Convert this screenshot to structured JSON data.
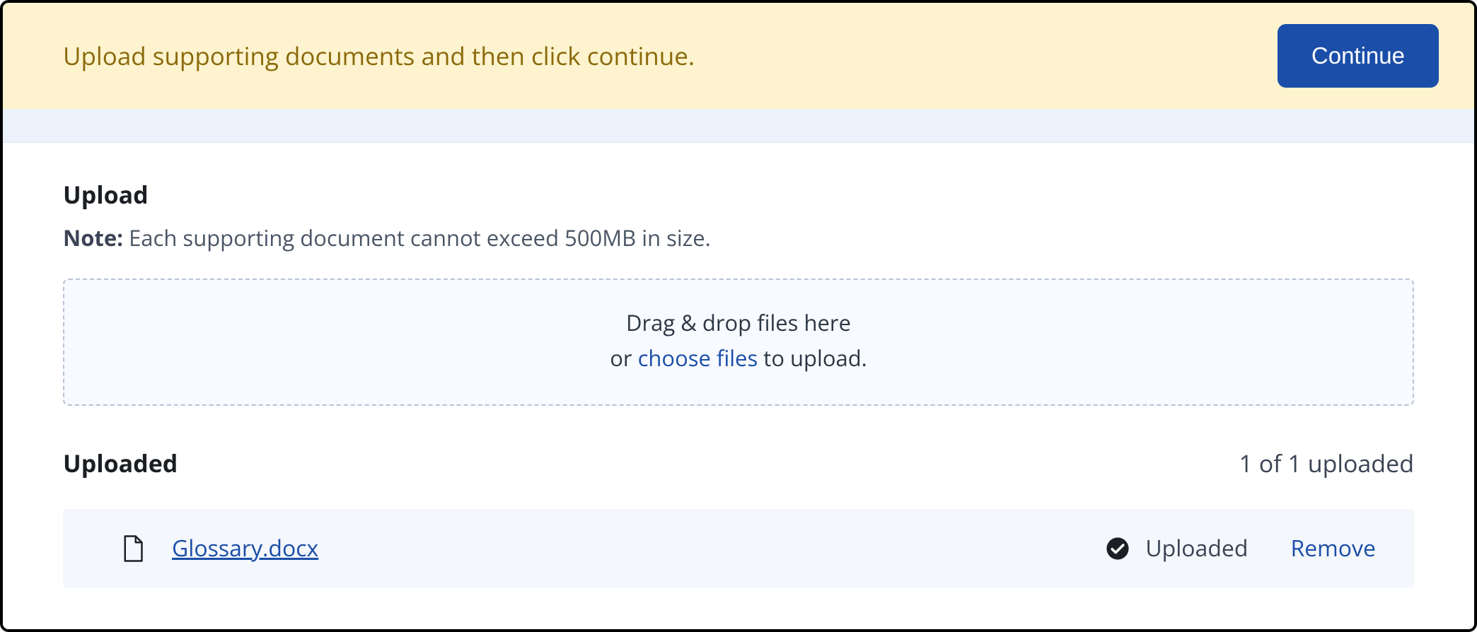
{
  "banner": {
    "message": "Upload supporting documents and then click continue.",
    "continue_label": "Continue"
  },
  "upload": {
    "title": "Upload",
    "note_label": "Note:",
    "note_text": " Each supporting document cannot exceed 500MB in size.",
    "dropzone": {
      "line1": "Drag & drop files here",
      "line2_prefix": "or ",
      "choose_files": "choose files",
      "line2_suffix": " to upload."
    }
  },
  "uploaded": {
    "title": "Uploaded",
    "count_text": "1 of 1 uploaded",
    "files": [
      {
        "name": "Glossary.docx",
        "status": "Uploaded",
        "remove_label": "Remove"
      }
    ]
  }
}
